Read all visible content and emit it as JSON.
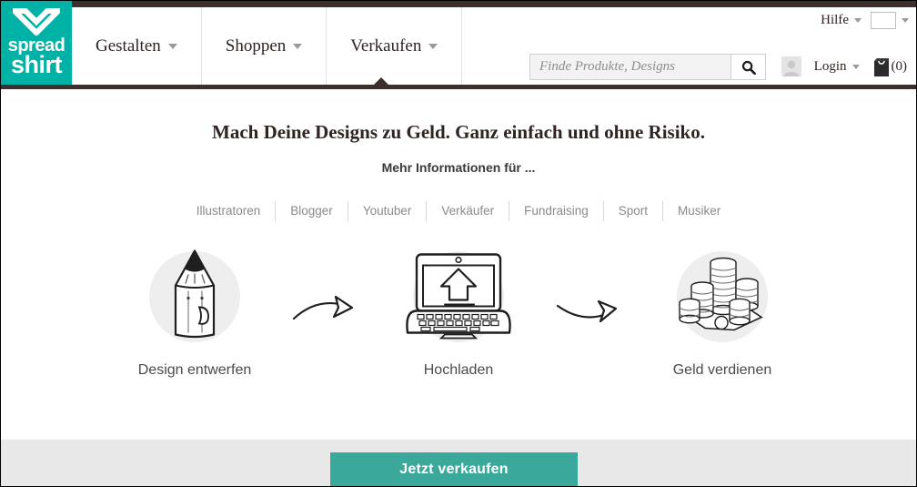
{
  "brand": {
    "logo_line1": "spread",
    "logo_line2": "shirt",
    "accent_color": "#00b2a5",
    "dark_color": "#3d302c"
  },
  "header": {
    "nav": [
      {
        "label": "Gestalten",
        "active": false
      },
      {
        "label": "Shoppen",
        "active": false
      },
      {
        "label": "Verkaufen",
        "active": true
      }
    ],
    "help_label": "Hilfe",
    "country_flag": "germany-flag",
    "search": {
      "placeholder": "Finde Produkte, Designs",
      "value": "",
      "button_icon": "search-icon"
    },
    "login_label": "Login",
    "cart_count": "(0)"
  },
  "main": {
    "headline": "Mach Deine Designs zu Geld. Ganz einfach und ohne Risiko.",
    "subheadline": "Mehr Informationen für ...",
    "audience_links": [
      "Illustratoren",
      "Blogger",
      "Youtuber",
      "Verkäufer",
      "Fundraising",
      "Sport",
      "Musiker"
    ],
    "steps": [
      {
        "label": "Design entwerfen",
        "icon": "pencil-icon"
      },
      {
        "label": "Hochladen",
        "icon": "laptop-upload-icon"
      },
      {
        "label": "Geld verdienen",
        "icon": "coins-icon"
      }
    ]
  },
  "footer": {
    "cta_label": "Jetzt verkaufen",
    "cta_color": "#3aa99b"
  }
}
